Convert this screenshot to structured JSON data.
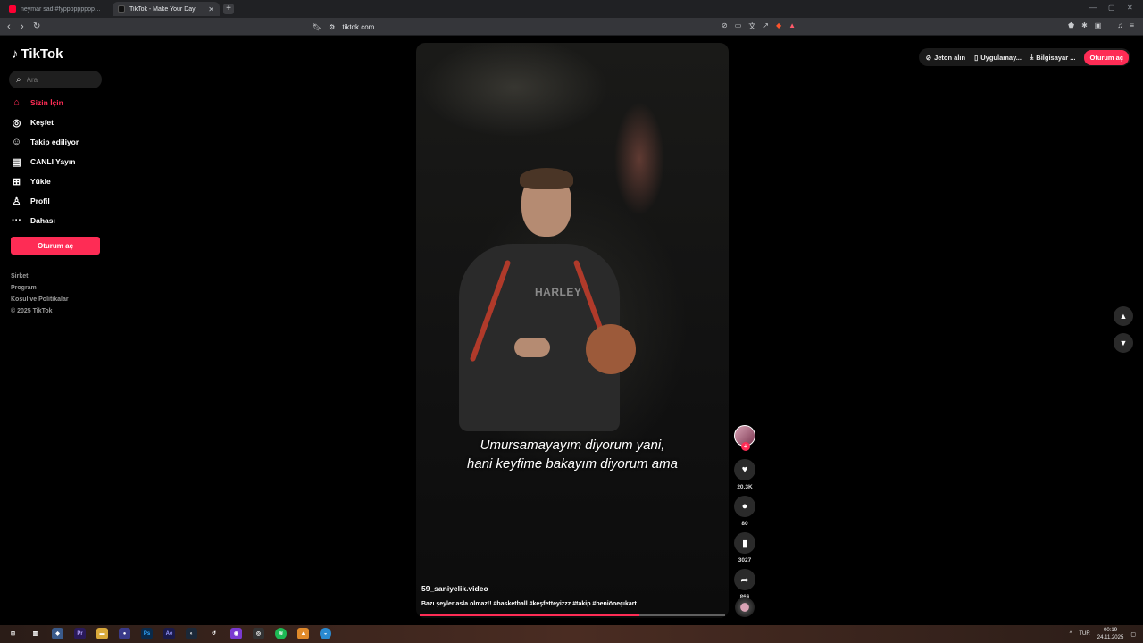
{
  "browser": {
    "tabs": [
      {
        "title": "neymar sad #fyppppppppppppppp",
        "active": false,
        "favicon": "youtube-icon"
      },
      {
        "title": "TikTok - Make Your Day",
        "active": true,
        "favicon": "tiktok-icon"
      }
    ],
    "new_tab": "+",
    "url": "tiktok.com",
    "window_controls": {
      "minimize": "—",
      "maximize": "▢",
      "close": "✕"
    }
  },
  "sidebar": {
    "logo": "TikTok",
    "search_placeholder": "Ara",
    "items": [
      {
        "label": "Sizin İçin",
        "icon": "home-icon",
        "active": true
      },
      {
        "label": "Keşfet",
        "icon": "compass-icon",
        "active": false
      },
      {
        "label": "Takip ediliyor",
        "icon": "following-icon",
        "active": false
      },
      {
        "label": "CANLI Yayın",
        "icon": "live-icon",
        "active": false
      },
      {
        "label": "Yükle",
        "icon": "upload-icon",
        "active": false
      },
      {
        "label": "Profil",
        "icon": "profile-icon",
        "active": false
      },
      {
        "label": "Dahası",
        "icon": "more-icon",
        "active": false
      }
    ],
    "login_button": "Oturum aç",
    "footer": [
      "Şirket",
      "Program",
      "Koşul ve Politikalar",
      "© 2025 TikTok"
    ]
  },
  "top_actions": {
    "coins": "Jeton alın",
    "app": "Uygulamay...",
    "desktop": "Bilgisayar ...",
    "login": "Oturum aç"
  },
  "video": {
    "shirt_text": "HARLEY",
    "subtitle_line1": "Umursamayayım diyorum yani,",
    "subtitle_line2": "hani keyfime bakayım diyorum ama",
    "username": "59_saniyelik.video",
    "description": "Bazı şeyler asla olmaz!! #basketball #keşfetteyizzz #takip #beniöneçıkart",
    "progress": 0.72
  },
  "actions": {
    "likes": "20.3K",
    "comments": "80",
    "saves": "3027",
    "shares": "866"
  },
  "taskbar": {
    "lang": "TUR",
    "time": "00:19",
    "date": "24.11.2025"
  },
  "colors": {
    "accent": "#fe2c55",
    "background": "#000000"
  }
}
